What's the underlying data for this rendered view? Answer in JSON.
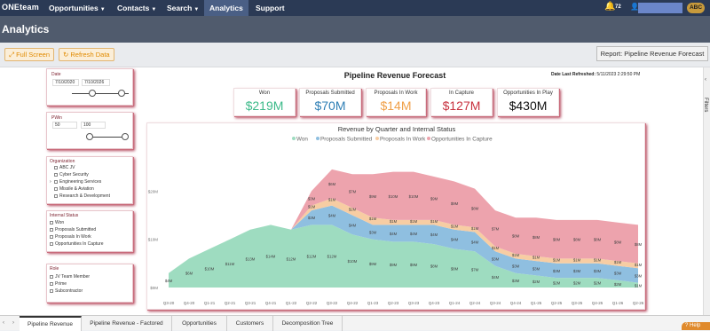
{
  "nav": {
    "brand_prefix": "ONE",
    "brand_suffix": "team",
    "items": [
      "Opportunities",
      "Contacts",
      "Search",
      "Analytics",
      "Support"
    ],
    "notification_count": "72",
    "user_badge": "ABC"
  },
  "page": {
    "title": "Analytics"
  },
  "toolbar": {
    "full_screen": "Full Screen",
    "refresh_data": "Refresh Data",
    "report": "Report: Pipeline Revenue Forecast"
  },
  "filters_label": "Filters",
  "slicers": {
    "date": {
      "label": "Date",
      "from": "7/10/2020",
      "to": "7/10/2026"
    },
    "prob": {
      "label": "PWin",
      "min": "50",
      "max": "100"
    },
    "organization": {
      "label": "Organization",
      "items": [
        "ABC JV",
        "Cyber Security",
        "Engineering Services",
        "Missile & Aviation",
        "Research & Development"
      ]
    },
    "internal_status": {
      "label": "Internal Status",
      "items": [
        "Won",
        "Proposals Submitted",
        "Proposals In Work",
        "Opportunities In Capture"
      ]
    },
    "role": {
      "label": "Role",
      "items": [
        "JV Team Member",
        "Prime",
        "Subcontractor"
      ]
    }
  },
  "report": {
    "title": "Pipeline Revenue Forecast",
    "refreshed_label": "Date Last Refreshed:",
    "refreshed_value": "5/11/2023 2:29:50 PM"
  },
  "kpis": [
    {
      "label": "Won",
      "value": "$219M",
      "color": "#3dba8a"
    },
    {
      "label": "Proposals Submitted",
      "value": "$70M",
      "color": "#2f7fb5"
    },
    {
      "label": "Proposals In Work",
      "value": "$14M",
      "color": "#f0a048"
    },
    {
      "label": "In Capture",
      "value": "$127M",
      "color": "#c8323f"
    },
    {
      "label": "Opportunities In Play",
      "value": "$430M",
      "color": "#111111"
    }
  ],
  "chart_data": {
    "type": "area",
    "title": "Revenue by Quarter and Internal Status",
    "categories": [
      "Q3-20",
      "Q4-20",
      "Q1-21",
      "Q2-21",
      "Q3-21",
      "Q4-21",
      "Q1-22",
      "Q2-22",
      "Q3-22",
      "Q4-22",
      "Q1-23",
      "Q2-23",
      "Q3-23",
      "Q4-23",
      "Q1-24",
      "Q2-24",
      "Q3-24",
      "Q4-24",
      "Q1-25",
      "Q2-25",
      "Q3-25",
      "Q4-25",
      "Q1-26",
      "Q2-26"
    ],
    "series": [
      {
        "name": "Won",
        "color": "#9edcc0",
        "values": [
          3,
          6,
          8,
          10,
          12,
          13,
          12,
          13,
          13,
          11,
          10,
          9.5,
          9.5,
          9,
          8,
          7.5,
          4.5,
          3,
          2.5,
          2,
          2,
          2,
          1.5,
          1
        ]
      },
      {
        "name": "Proposals Submitted",
        "color": "#8fbfe0",
        "values": [
          0,
          0,
          0,
          0,
          0,
          0,
          0,
          3,
          4,
          4,
          3,
          3.5,
          3.5,
          4,
          4,
          4,
          3,
          3,
          3,
          3,
          3,
          3,
          3,
          3
        ]
      },
      {
        "name": "Proposals In Work",
        "color": "#f7cda3",
        "values": [
          0,
          0,
          0,
          0,
          0,
          0,
          0,
          1,
          1.5,
          1.5,
          1.5,
          1,
          1,
          1,
          1,
          1,
          1,
          1,
          1,
          1,
          1,
          1,
          1,
          1
        ]
      },
      {
        "name": "Opportunities In Capture",
        "color": "#eda3ad",
        "values": [
          0,
          0,
          0,
          0,
          0,
          0,
          0,
          3,
          6,
          7,
          9,
          10,
          10,
          9,
          9,
          8,
          7.5,
          7.5,
          8,
          8,
          8,
          8,
          8,
          8
        ]
      }
    ],
    "yticks": [
      "$0M",
      "$10M",
      "$20M"
    ],
    "ylim": [
      0,
      30
    ],
    "point_labels": [
      [
        "$4M",
        "$6M",
        "$10M",
        "$11M",
        "$13M",
        "$14M",
        "$12M",
        "$12M",
        "$12M",
        "$10M",
        "$9M",
        "$9M",
        "$9M",
        "$8M",
        "$8M",
        "$7M",
        "$4M",
        "$3M",
        "$2M",
        "$2M",
        "$2M",
        "$2M",
        "$2M",
        "$1M"
      ],
      [
        "",
        "",
        "",
        "",
        "",
        "",
        "",
        "$3M",
        "$4M",
        "$4M",
        "$3M",
        "$4M",
        "$4M",
        "$4M",
        "$4M",
        "$4M",
        "$3M",
        "$3M",
        "$3M",
        "$3M",
        "$3M",
        "$3M",
        "$3M",
        "$3M"
      ],
      [
        "",
        "",
        "",
        "",
        "",
        "",
        "",
        "$1M",
        "$1M",
        "$2M",
        "$1M",
        "$1M",
        "$1M",
        "$1M",
        "$1M",
        "$1M",
        "$1M",
        "$1M",
        "$1M",
        "$1M",
        "$1M",
        "$1M",
        "$1M",
        "$1M"
      ],
      [
        "",
        "",
        "",
        "",
        "",
        "",
        "",
        "$3M",
        "$6M",
        "$7M",
        "$9M",
        "$10M",
        "$10M",
        "$9M",
        "$9M",
        "$8M",
        "$7M",
        "$8M",
        "$8M",
        "$8M",
        "$8M",
        "$8M",
        "$8M",
        "$8M"
      ]
    ]
  },
  "tabs": [
    "Pipeline Revenue",
    "Pipeline Revenue - Factored",
    "Opportunities",
    "Customers",
    "Decomposition Tree"
  ],
  "help": "Help"
}
